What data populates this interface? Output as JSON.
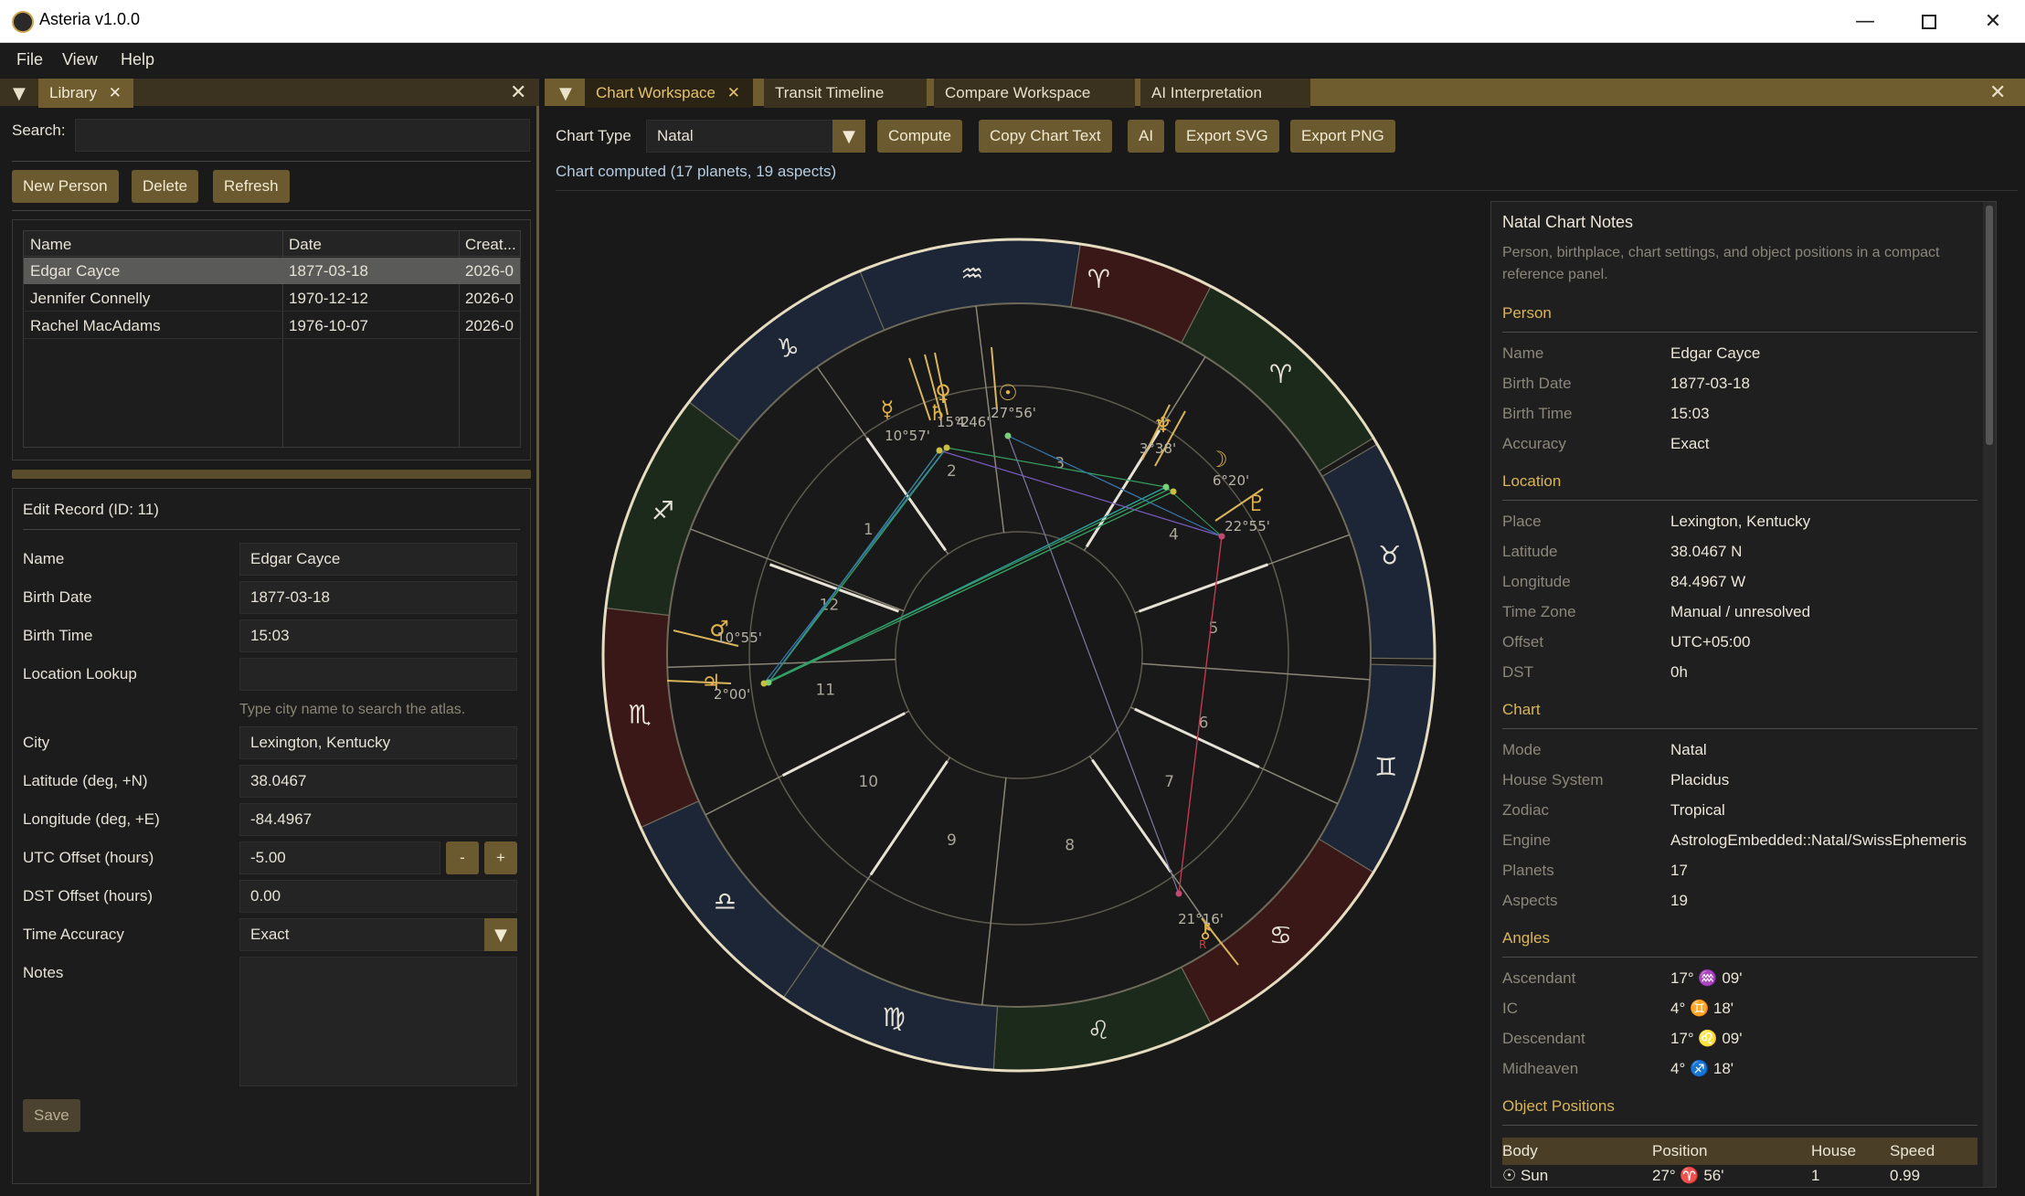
{
  "window": {
    "title": "Asteria v1.0.0"
  },
  "menu": [
    "File",
    "View",
    "Help"
  ],
  "library": {
    "tab_label": "Library",
    "search_label": "Search:",
    "search_value": "",
    "buttons": {
      "new_person": "New Person",
      "delete": "Delete",
      "refresh": "Refresh"
    },
    "columns": [
      "Name",
      "Date",
      "Creat..."
    ],
    "rows": [
      {
        "name": "Edgar Cayce",
        "date": "1877-03-18",
        "created": "2026-0"
      },
      {
        "name": "Jennifer Connelly",
        "date": "1970-12-12",
        "created": "2026-0"
      },
      {
        "name": "Rachel MacAdams",
        "date": "1976-10-07",
        "created": "2026-0"
      }
    ],
    "selected_row": 0
  },
  "edit": {
    "title": "Edit Record  (ID: 11)",
    "fields": {
      "name_label": "Name",
      "name": "Edgar Cayce",
      "birth_date_label": "Birth Date",
      "birth_date": "1877-03-18",
      "birth_time_label": "Birth Time",
      "birth_time": "15:03",
      "location_lookup_label": "Location Lookup",
      "location_lookup": "",
      "location_hint": "Type city name to search the atlas.",
      "city_label": "City",
      "city": "Lexington, Kentucky",
      "latitude_label": "Latitude (deg, +N)",
      "latitude": "38.0467",
      "longitude_label": "Longitude (deg, +E)",
      "longitude": "-84.4967",
      "utc_label": "UTC Offset (hours)",
      "utc": "-5.00",
      "dst_label": "DST Offset (hours)",
      "dst": "0.00",
      "accuracy_label": "Time Accuracy",
      "accuracy": "Exact",
      "notes_label": "Notes",
      "notes": ""
    },
    "minus": "-",
    "plus": "+",
    "save": "Save"
  },
  "workspace": {
    "tabs": [
      "Chart Workspace",
      "Transit Timeline",
      "Compare Workspace",
      "AI Interpretation"
    ],
    "chart_type_label": "Chart Type",
    "chart_type": "Natal",
    "buttons": {
      "compute": "Compute",
      "copy": "Copy Chart Text",
      "ai": "AI",
      "svg": "Export SVG",
      "png": "Export PNG"
    },
    "status": "Chart computed (17 planets, 19 aspects)"
  },
  "wheel": {
    "signs": [
      "♈",
      "♉",
      "♊",
      "♋",
      "♌",
      "♍",
      "♎",
      "♏",
      "♐",
      "♑",
      "♒",
      "♓"
    ],
    "houses": [
      "1",
      "2",
      "3",
      "4",
      "5",
      "6",
      "7",
      "8",
      "9",
      "10",
      "11",
      "12"
    ],
    "planet_labels": [
      {
        "glyph": "☉",
        "deg": "27°56'"
      },
      {
        "glyph": "☿",
        "deg": "10°57'"
      },
      {
        "glyph": "♀",
        "deg": "15°2"
      },
      {
        "glyph": "♄",
        "deg": "4'46'"
      },
      {
        "glyph": "♆",
        "deg": "3°38'"
      },
      {
        "glyph": "☽",
        "deg": "6°20'"
      },
      {
        "glyph": "♇",
        "deg": "22°55'"
      },
      {
        "glyph": "♂",
        "deg": "10°55'"
      },
      {
        "glyph": "♃",
        "deg": "2°00'"
      },
      {
        "glyph": "⚷",
        "deg": "21°16'"
      }
    ],
    "retro": "R"
  },
  "notes": {
    "title": "Natal Chart Notes",
    "subtitle": "Person, birthplace, chart settings, and object positions in a compact reference panel.",
    "person_head": "Person",
    "person": [
      [
        "Name",
        "Edgar Cayce"
      ],
      [
        "Birth Date",
        "1877-03-18"
      ],
      [
        "Birth Time",
        "15:03"
      ],
      [
        "Accuracy",
        "Exact"
      ]
    ],
    "location_head": "Location",
    "location": [
      [
        "Place",
        "Lexington, Kentucky"
      ],
      [
        "Latitude",
        "38.0467 N"
      ],
      [
        "Longitude",
        "84.4967 W"
      ],
      [
        "Time Zone",
        "Manual / unresolved"
      ],
      [
        "Offset",
        "UTC+05:00"
      ],
      [
        "DST",
        "0h"
      ]
    ],
    "chart_head": "Chart",
    "chart": [
      [
        "Mode",
        "Natal"
      ],
      [
        "House System",
        "Placidus"
      ],
      [
        "Zodiac",
        "Tropical"
      ],
      [
        "Engine",
        "AstrologEmbedded::Natal/SwissEphemeris"
      ],
      [
        "Planets",
        "17"
      ],
      [
        "Aspects",
        "19"
      ]
    ],
    "angles_head": "Angles",
    "angles": [
      [
        "Ascendant",
        "17° ♒ 09'"
      ],
      [
        "IC",
        "4° ♊ 18'"
      ],
      [
        "Descendant",
        "17° ♌ 09'"
      ],
      [
        "Midheaven",
        "4° ♐ 18'"
      ]
    ],
    "objects_head": "Object Positions",
    "object_columns": [
      "Body",
      "Position",
      "House",
      "Speed"
    ],
    "object_partial": [
      "☉ Sun",
      "27° ♈ 56'",
      "1",
      "0.99"
    ]
  },
  "colors": {
    "accent": "#d9b55c",
    "button": "#6b5a30",
    "panel": "#191919"
  }
}
